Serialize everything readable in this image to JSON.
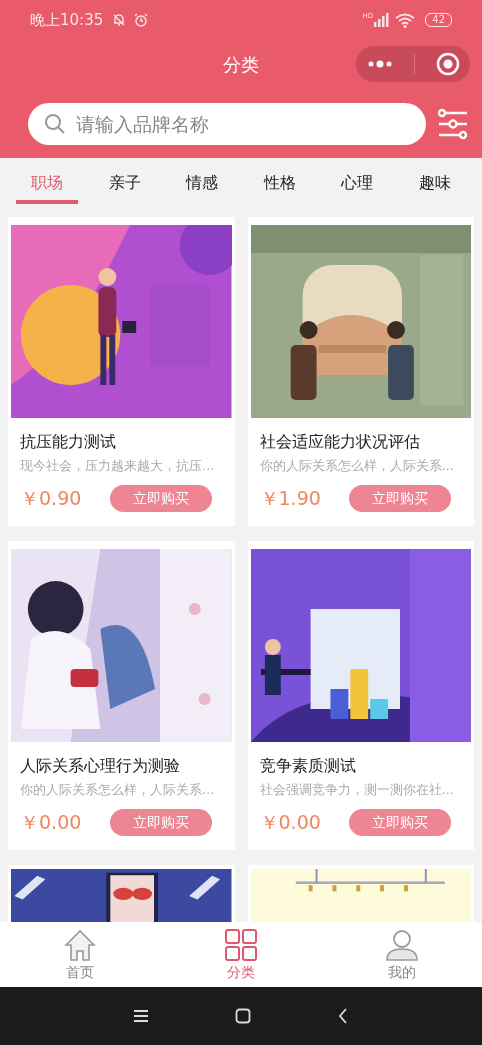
{
  "status_bar": {
    "time": "晚上10:35",
    "network": "HD",
    "battery": "42"
  },
  "header": {
    "title": "分类"
  },
  "search": {
    "placeholder": "请输入品牌名称"
  },
  "tabs": [
    {
      "label": "职场",
      "selected": true
    },
    {
      "label": "亲子",
      "selected": false
    },
    {
      "label": "情感",
      "selected": false
    },
    {
      "label": "性格",
      "selected": false
    },
    {
      "label": "心理",
      "selected": false
    },
    {
      "label": "趣味",
      "selected": false
    }
  ],
  "products": [
    {
      "kind": "product",
      "title": "抗压能力测试",
      "description": "现今社会，压力越来越大，抗压…",
      "price": "￥0.90",
      "button": "立即购买"
    },
    {
      "kind": "product",
      "title": "社会适应能力状况评估",
      "description": "你的人际关系怎么样，人际关系…",
      "price": "￥1.90",
      "button": "立即购买"
    },
    {
      "kind": "product",
      "title": "人际关系心理行为测验",
      "description": "你的人际关系怎么样，人际关系…",
      "price": "￥0.00",
      "button": "立即购买"
    },
    {
      "kind": "product",
      "title": "竞争素质测试",
      "description": "社会强调竞争力，测一测你在社…",
      "price": "￥0.00",
      "button": "立即购买"
    },
    {
      "kind": "picture"
    },
    {
      "kind": "picture"
    }
  ],
  "bottom_nav": [
    {
      "label": "首页",
      "kind": "home",
      "selected": false
    },
    {
      "label": "分类",
      "kind": "grid",
      "selected": true
    },
    {
      "label": "我的",
      "kind": "person",
      "selected": false
    }
  ]
}
